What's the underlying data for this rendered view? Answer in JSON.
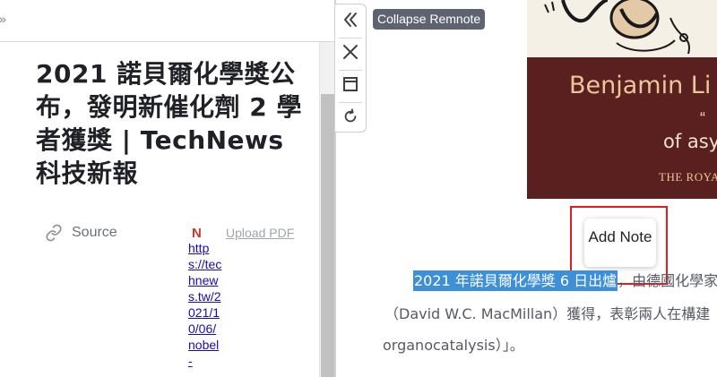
{
  "left_panel": {
    "expand_icon": "double-chevron-right-icon",
    "title": "2021 諾貝爾化學獎公布，發明新催化劑 2 學者獲獎 | TechNews 科技新報",
    "source_label": "Source",
    "source_badge": "N",
    "source_url": "https://technews.tw/2021/10/06/nobel-",
    "upload_pdf_label": "Upload PDF"
  },
  "toolbar": {
    "buttons": [
      {
        "name": "collapse-remnote",
        "icon": "double-chevron-left-icon"
      },
      {
        "name": "close",
        "icon": "close-icon"
      },
      {
        "name": "window",
        "icon": "window-icon"
      },
      {
        "name": "refresh",
        "icon": "refresh-icon"
      }
    ],
    "tooltip": "Collapse Remnote"
  },
  "book_cover": {
    "name": "Benjamin Li",
    "quote_mark": "“",
    "subtitle": "of asy",
    "publisher": "THE ROYA"
  },
  "popup": {
    "add_note_label": "Add Note"
  },
  "article": {
    "line1_selected": "2021 年諾貝爾化學獎 6 日出爐",
    "line1_rest": "，由德國化學家",
    "line2": "（David W.C. MacMillan）獲得，表彰兩人在構建",
    "line3": "organocatalysis）」。"
  },
  "colors": {
    "selection": "#3d8fd8",
    "highlight_box": "#e41b23",
    "book_background": "#5a1f1f",
    "book_gold": "#e9c79a",
    "tooltip_bg": "#5e6370"
  }
}
